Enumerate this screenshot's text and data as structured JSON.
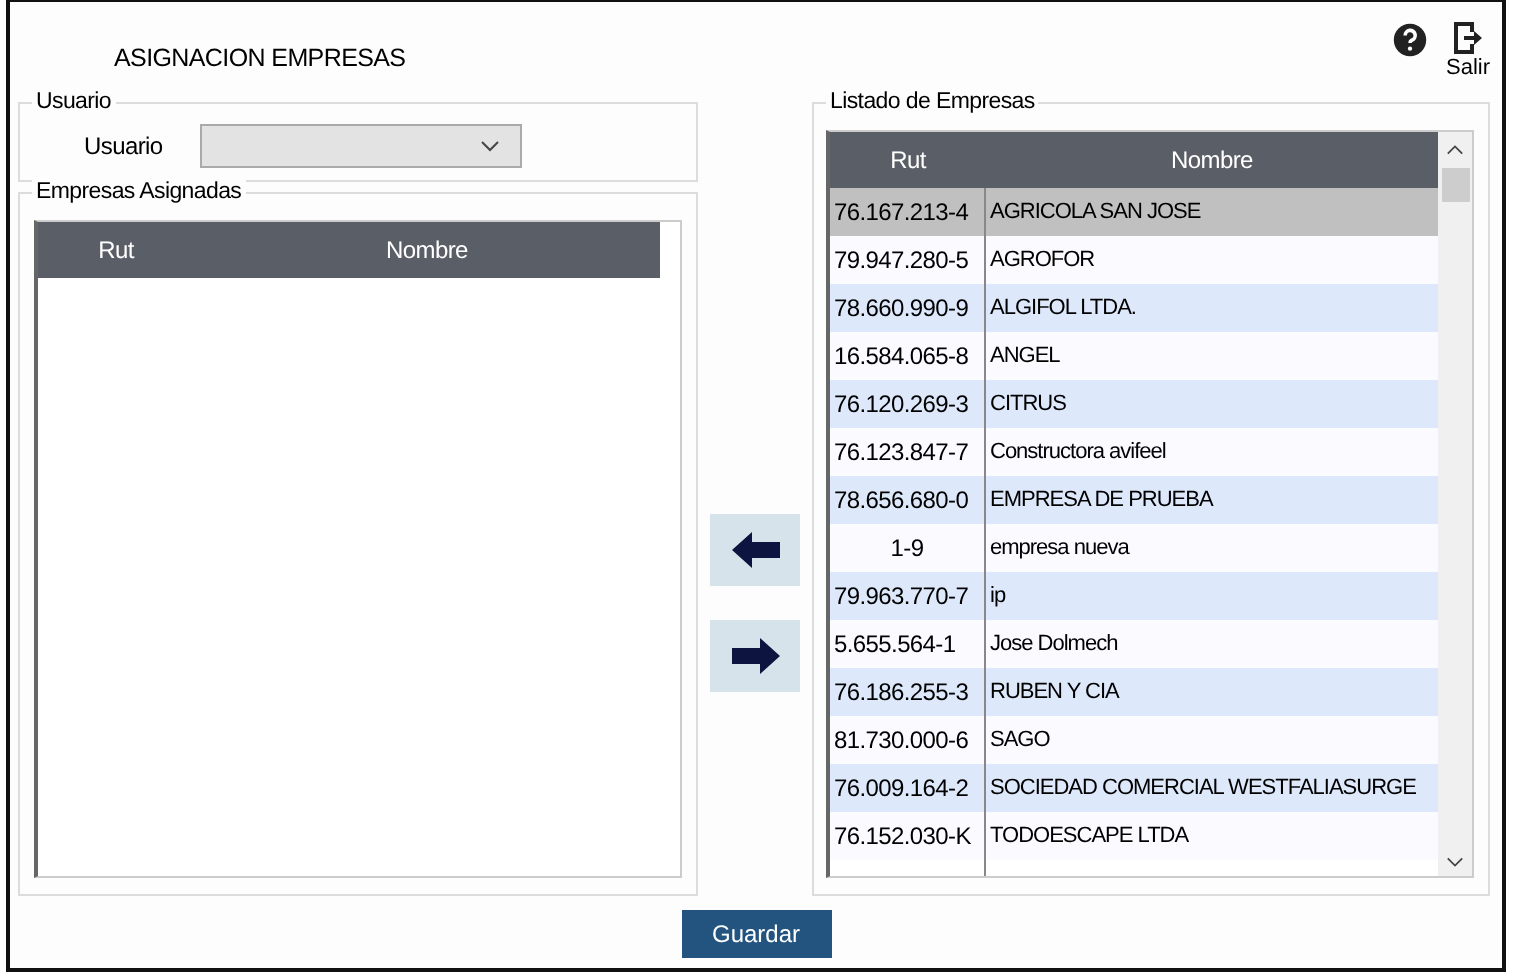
{
  "window": {
    "title": "ASIGNACION EMPRESAS"
  },
  "toolbar": {
    "exit_label": "Salir"
  },
  "usuario_group": {
    "legend": "Usuario",
    "label": "Usuario",
    "value_disabled": true
  },
  "assigned": {
    "legend": "Empresas Asignadas",
    "columns": [
      "Rut",
      "Nombre"
    ]
  },
  "listing": {
    "legend": "Listado de Empresas",
    "columns": [
      "Rut",
      "Nombre"
    ],
    "rows": [
      {
        "rut": "76.167.213-4",
        "nombre": "AGRICOLA SAN JOSE",
        "selected": true
      },
      {
        "rut": "79.947.280-5",
        "nombre": "AGROFOR",
        "selected": false
      },
      {
        "rut": "78.660.990-9",
        "nombre": "ALGIFOL LTDA.",
        "selected": false
      },
      {
        "rut": "16.584.065-8",
        "nombre": "ANGEL",
        "selected": false
      },
      {
        "rut": "76.120.269-3",
        "nombre": "CITRUS",
        "selected": false
      },
      {
        "rut": "76.123.847-7",
        "nombre": "Constructora avifeel",
        "selected": false
      },
      {
        "rut": "78.656.680-0",
        "nombre": "EMPRESA DE PRUEBA",
        "selected": false
      },
      {
        "rut": "1-9",
        "nombre": "empresa nueva",
        "selected": false
      },
      {
        "rut": "79.963.770-7",
        "nombre": "ip",
        "selected": false
      },
      {
        "rut": "5.655.564-1",
        "nombre": "Jose Dolmech",
        "selected": false
      },
      {
        "rut": "76.186.255-3",
        "nombre": "RUBEN Y CIA",
        "selected": false
      },
      {
        "rut": "81.730.000-6",
        "nombre": "SAGO",
        "selected": false
      },
      {
        "rut": "76.009.164-2",
        "nombre": "SOCIEDAD COMERCIAL WESTFALIASURGE",
        "selected": false
      },
      {
        "rut": "76.152.030-K",
        "nombre": "TODOESCAPE LTDA",
        "selected": false
      }
    ]
  },
  "buttons": {
    "save": "Guardar"
  }
}
